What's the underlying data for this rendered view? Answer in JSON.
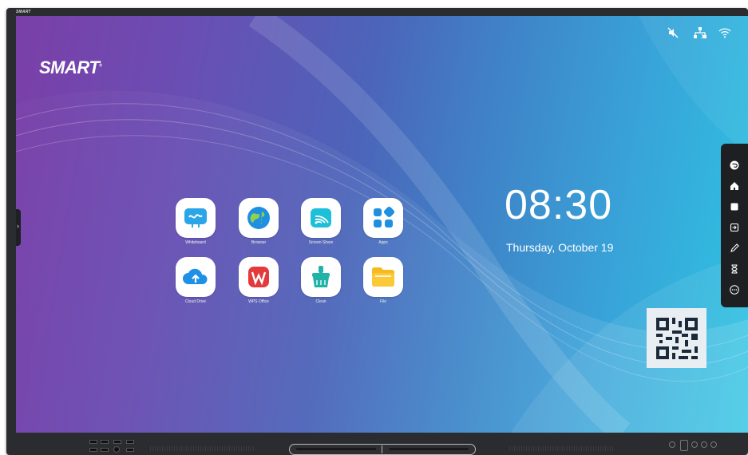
{
  "frame": {
    "brand": "SMART"
  },
  "screen": {
    "logo": "SMART",
    "logo_mark": "®",
    "status_icons": [
      "mute-icon",
      "network-disconnected-icon",
      "wifi-icon"
    ],
    "apps": [
      {
        "label": "Whiteboard",
        "icon": "whiteboard-icon"
      },
      {
        "label": "Browser",
        "icon": "globe-icon"
      },
      {
        "label": "Screen Share",
        "icon": "screen-share-icon"
      },
      {
        "label": "Apps",
        "icon": "apps-grid-icon"
      },
      {
        "label": "Cloud Drive",
        "icon": "cloud-upload-icon"
      },
      {
        "label": "WPS Office",
        "icon": "wps-office-icon"
      },
      {
        "label": "Clean",
        "icon": "clean-brush-icon"
      },
      {
        "label": "File",
        "icon": "folder-icon"
      }
    ],
    "clock": {
      "time": "08:30",
      "date": "Thursday, October 19"
    },
    "qr_icon": "qr-code-icon",
    "side_toolbar": [
      "back-icon",
      "home-icon",
      "stop-icon",
      "input-source-icon",
      "pen-icon",
      "timer-icon",
      "more-icon"
    ],
    "left_handle": "›"
  },
  "colors": {
    "bg_left": "#7a3fa8",
    "bg_right": "#2ec4e2",
    "toolbar": "#1e1f22",
    "frame": "#2b2c2f"
  }
}
